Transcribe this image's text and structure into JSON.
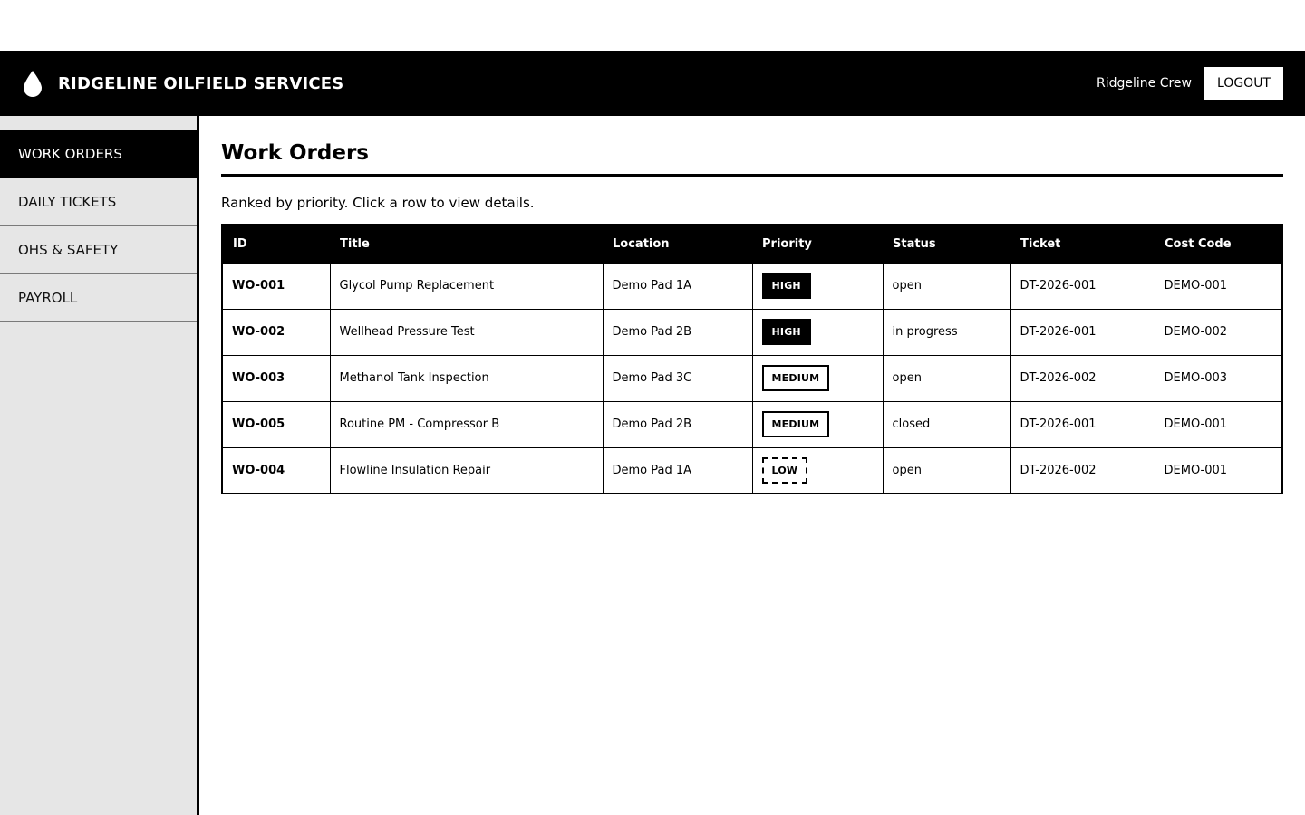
{
  "header": {
    "brand": "RIDGELINE OILFIELD SERVICES",
    "logo_icon": "droplet-icon",
    "user": "Ridgeline Crew",
    "logout_label": "LOGOUT"
  },
  "sidebar": {
    "items": [
      {
        "label": "WORK ORDERS",
        "active": true
      },
      {
        "label": "DAILY TICKETS",
        "active": false
      },
      {
        "label": "OHS & SAFETY",
        "active": false
      },
      {
        "label": "PAYROLL",
        "active": false
      }
    ]
  },
  "main": {
    "title": "Work Orders",
    "subtitle": "Ranked by priority. Click a row to view details.",
    "table": {
      "columns": [
        "ID",
        "Title",
        "Location",
        "Priority",
        "Status",
        "Ticket",
        "Cost Code"
      ],
      "rows": [
        {
          "id": "WO-001",
          "title": "Glycol Pump Replacement",
          "location": "Demo Pad 1A",
          "priority": "HIGH",
          "status": "open",
          "ticket": "DT-2026-001",
          "cost_code": "DEMO-001"
        },
        {
          "id": "WO-002",
          "title": "Wellhead Pressure Test",
          "location": "Demo Pad 2B",
          "priority": "HIGH",
          "status": "in progress",
          "ticket": "DT-2026-001",
          "cost_code": "DEMO-002"
        },
        {
          "id": "WO-003",
          "title": "Methanol Tank Inspection",
          "location": "Demo Pad 3C",
          "priority": "MEDIUM",
          "status": "open",
          "ticket": "DT-2026-002",
          "cost_code": "DEMO-003"
        },
        {
          "id": "WO-005",
          "title": "Routine PM - Compressor B",
          "location": "Demo Pad 2B",
          "priority": "MEDIUM",
          "status": "closed",
          "ticket": "DT-2026-001",
          "cost_code": "DEMO-001"
        },
        {
          "id": "WO-004",
          "title": "Flowline Insulation Repair",
          "location": "Demo Pad 1A",
          "priority": "LOW",
          "status": "open",
          "ticket": "DT-2026-002",
          "cost_code": "DEMO-001"
        }
      ]
    }
  }
}
